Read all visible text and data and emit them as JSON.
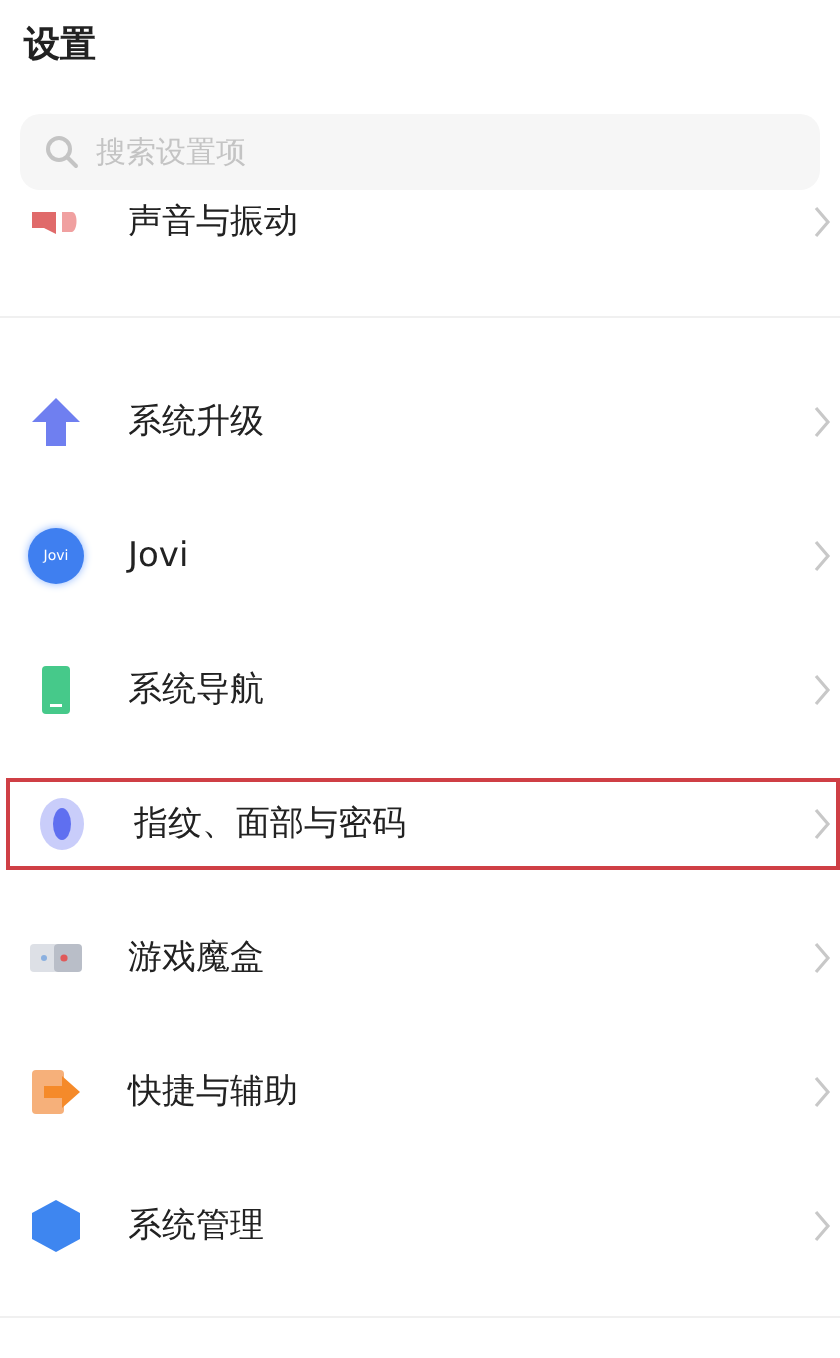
{
  "title": "设置",
  "search": {
    "placeholder": "搜索设置项"
  },
  "groups": [
    {
      "items": [
        {
          "kind": "sound",
          "label": "声音与振动",
          "highlighted": false
        }
      ]
    },
    {
      "items": [
        {
          "kind": "upgrade",
          "label": "系统升级",
          "highlighted": false
        },
        {
          "kind": "jovi",
          "label": "Jovi",
          "icon_text": "Jovi",
          "highlighted": false
        },
        {
          "kind": "navigation",
          "label": "系统导航",
          "highlighted": false
        },
        {
          "kind": "fingerprint",
          "label": "指纹、面部与密码",
          "highlighted": true
        },
        {
          "kind": "game",
          "label": "游戏魔盒",
          "highlighted": false
        },
        {
          "kind": "shortcut",
          "label": "快捷与辅助",
          "highlighted": false
        },
        {
          "kind": "manage",
          "label": "系统管理",
          "highlighted": false
        }
      ]
    }
  ]
}
